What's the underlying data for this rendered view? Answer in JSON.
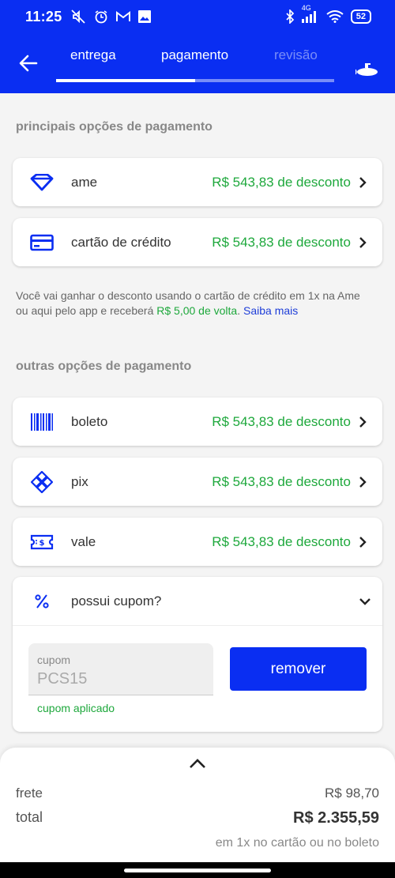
{
  "status_bar": {
    "time": "11:25",
    "network": "4G",
    "battery": "52",
    "icons": [
      "silent-icon",
      "alarm-icon",
      "gmail-icon",
      "image-icon",
      "bluetooth-icon",
      "signal-icon",
      "wifi-icon"
    ]
  },
  "header": {
    "steps": [
      {
        "label": "entrega"
      },
      {
        "label": "pagamento"
      },
      {
        "label": "revisão"
      }
    ],
    "progress": 0.5,
    "accent_color": "#0a2ef2"
  },
  "main_options": {
    "title": "principais opções de pagamento",
    "items": [
      {
        "name": "ame",
        "discount": "R$ 543,83 de desconto",
        "icon": "ame-heart-icon"
      },
      {
        "name": "cartão de crédito",
        "discount": "R$ 543,83 de desconto",
        "icon": "credit-card-icon"
      }
    ]
  },
  "info": {
    "text1": "Você vai ganhar o desconto usando o cartão de crédito em 1x na Ame ou aqui pelo app e receberá ",
    "cashback": "R$ 5,00 de volta",
    "text2": ". ",
    "link": "Saiba mais"
  },
  "other_options": {
    "title": "outras opções de pagamento",
    "items": [
      {
        "name": "boleto",
        "discount": "R$ 543,83 de desconto",
        "icon": "barcode-icon"
      },
      {
        "name": "pix",
        "discount": "R$ 543,83 de desconto",
        "icon": "pix-icon"
      },
      {
        "name": "vale",
        "discount": "R$ 543,83 de desconto",
        "icon": "voucher-icon"
      }
    ]
  },
  "coupon": {
    "title": "possui cupom?",
    "field_label": "cupom",
    "field_value": "PCS15",
    "status": "cupom aplicado",
    "button": "remover"
  },
  "summary": {
    "frete_label": "frete",
    "frete_value": "R$ 98,70",
    "total_label": "total",
    "total_value": "R$ 2.355,59",
    "installments": "em 1x no cartão ou no boleto"
  },
  "colors": {
    "brand_blue": "#0a2ef2",
    "discount_green": "#1ea83c"
  }
}
